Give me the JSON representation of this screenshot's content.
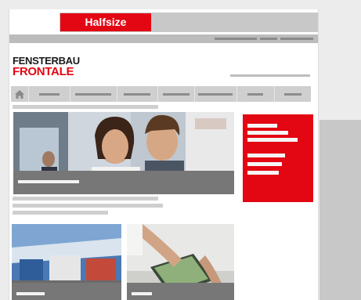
{
  "topbar": {
    "halfsize_label": "Halfsize"
  },
  "logo": {
    "line1": "FENSTERBAU",
    "line2": "FRONTALE"
  },
  "colors": {
    "accent": "#e30613",
    "bar": "#c8c8c8",
    "caption": "#777777"
  },
  "nav": {
    "home_icon": "home-icon",
    "items": 8
  }
}
